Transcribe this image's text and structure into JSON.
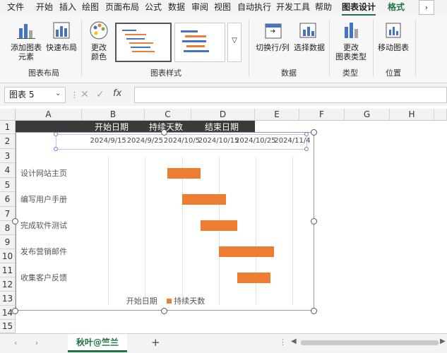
{
  "menu": [
    "文件",
    "开始",
    "插入",
    "绘图",
    "页面布局",
    "公式",
    "数据",
    "审阅",
    "视图",
    "自动执行",
    "开发工具",
    "帮助",
    "图表设计",
    "格式"
  ],
  "ribbon": {
    "add_element": [
      "添加图表",
      "元素"
    ],
    "quick_layout": [
      "快速布局"
    ],
    "change_colors": [
      "更改",
      "颜色"
    ],
    "switch_row_col": "切换行/列",
    "select_data": "选择数据",
    "change_type": [
      "更改",
      "图表类型"
    ],
    "move_chart": "移动图表",
    "groups": [
      "图表布局",
      "图表样式",
      "数据",
      "类型",
      "位置"
    ]
  },
  "formula": {
    "name_box": "图表 5",
    "fx": "fx"
  },
  "columns": [
    "A",
    "B",
    "C",
    "D",
    "E",
    "F",
    "G",
    "H"
  ],
  "rows": [
    "1",
    "2",
    "3",
    "4",
    "5",
    "6",
    "7",
    "8",
    "9",
    "10",
    "11",
    "12",
    "13",
    "14",
    "15"
  ],
  "row1_headers": [
    "开始日期",
    "持续天数",
    "结束日期"
  ],
  "chart_data": {
    "type": "bar",
    "subtype": "gantt (stacked bar, start series hidden)",
    "x_tick_labels": [
      "2024/9/15",
      "2024/9/25",
      "2024/10/5",
      "2024/10/15",
      "2024/10/25",
      "2024/11/4"
    ],
    "categories": [
      "设计网站主页",
      "编写用户手册",
      "完成软件测试",
      "发布营销邮件",
      "收集客户反馈"
    ],
    "series": [
      {
        "name": "开始日期",
        "values": [
          "2024/10/1",
          "2024/10/5",
          "2024/10/10",
          "2024/10/15",
          "2024/10/20"
        ],
        "color": "none"
      },
      {
        "name": "持续天数",
        "values": [
          9,
          12,
          10,
          15,
          9
        ],
        "color": "#ed7d31"
      }
    ],
    "xlim": [
      "2024/9/5",
      "2024/11/4"
    ],
    "grid": true,
    "legend": "bottom"
  },
  "sheet_tab": "秋叶@竺兰",
  "add_sheet": "+"
}
